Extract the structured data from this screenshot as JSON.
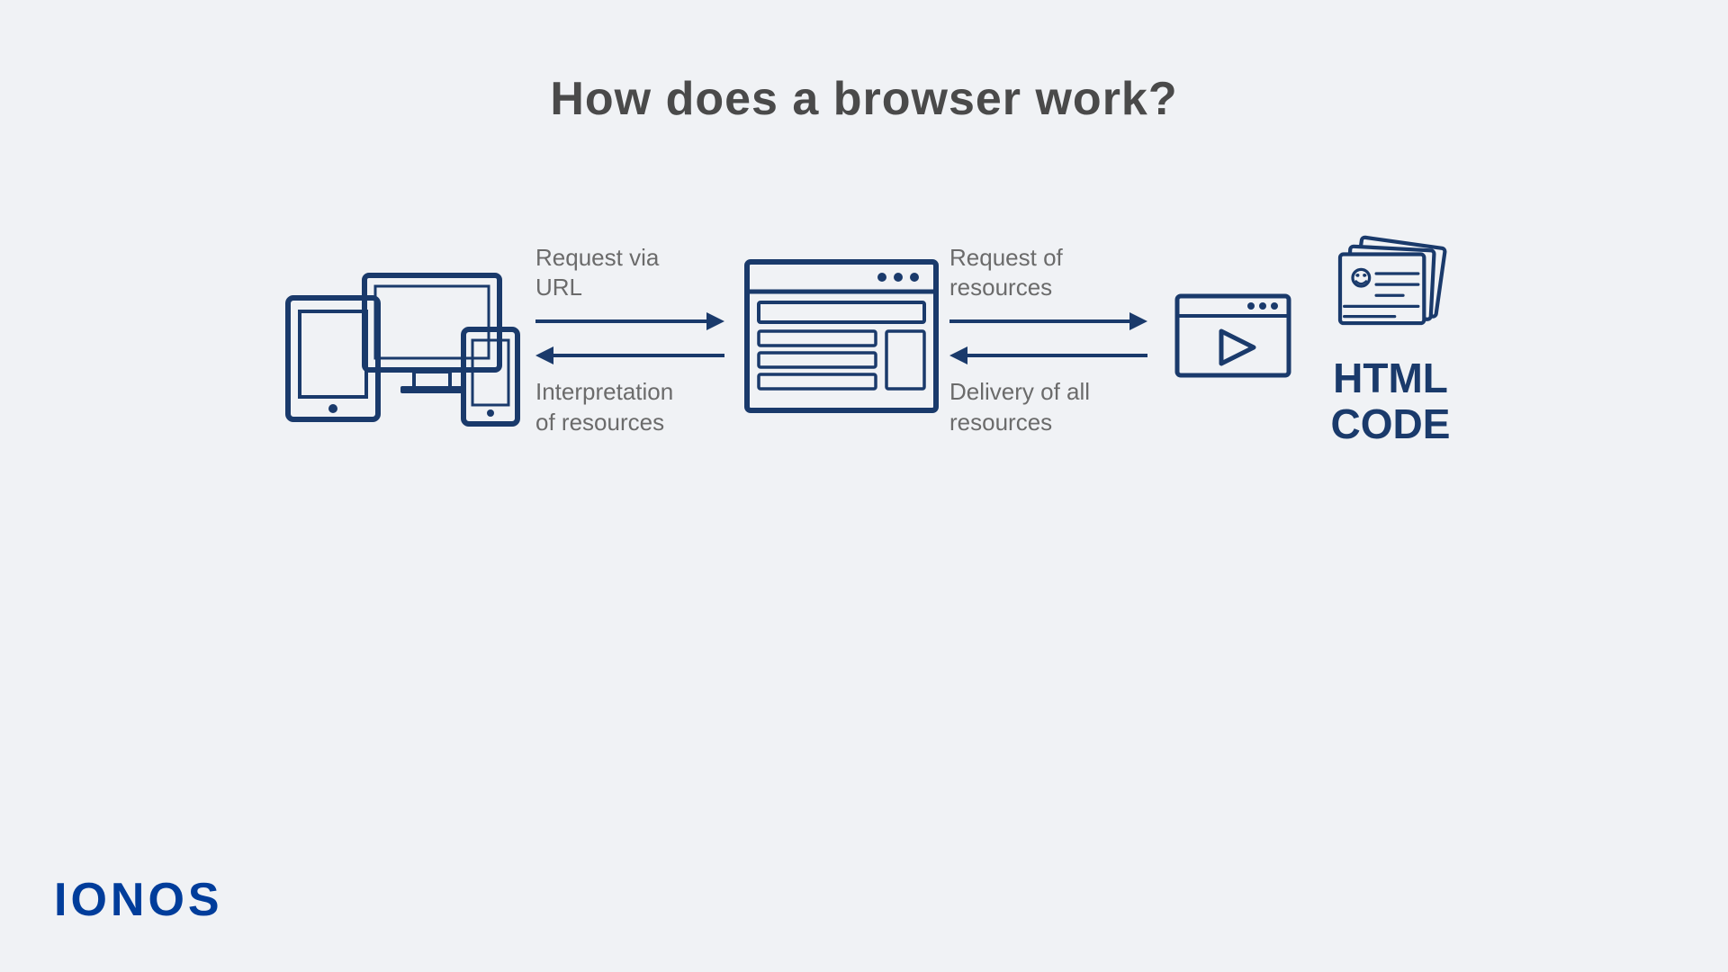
{
  "page": {
    "title": "How does a browser work?",
    "background_color": "#f0f2f5"
  },
  "diagram": {
    "step1": {
      "label": "devices-icon",
      "description": "Multiple devices (tablet, desktop, phone)"
    },
    "arrow1": {
      "top_label_line1": "Request via",
      "top_label_line2": "URL",
      "bottom_label_line1": "Interpretation",
      "bottom_label_line2": "of resources"
    },
    "step2": {
      "label": "browser-window-icon",
      "description": "Browser window"
    },
    "arrow2": {
      "top_label_line1": "Request of",
      "top_label_line2": "resources",
      "bottom_label_line1": "Delivery of all",
      "bottom_label_line2": "resources"
    },
    "step3": {
      "label": "video-player-icon",
      "description": "Video player"
    },
    "step4": {
      "label": "html-code-icon",
      "html_text_line1": "HTML",
      "html_text_line2": "CODE"
    }
  },
  "logo": {
    "text": "IONOS"
  },
  "colors": {
    "dark_blue": "#1a3a6b",
    "medium_blue": "#003d9b",
    "text_gray": "#6b6b6b",
    "title_gray": "#4a4a4a"
  }
}
